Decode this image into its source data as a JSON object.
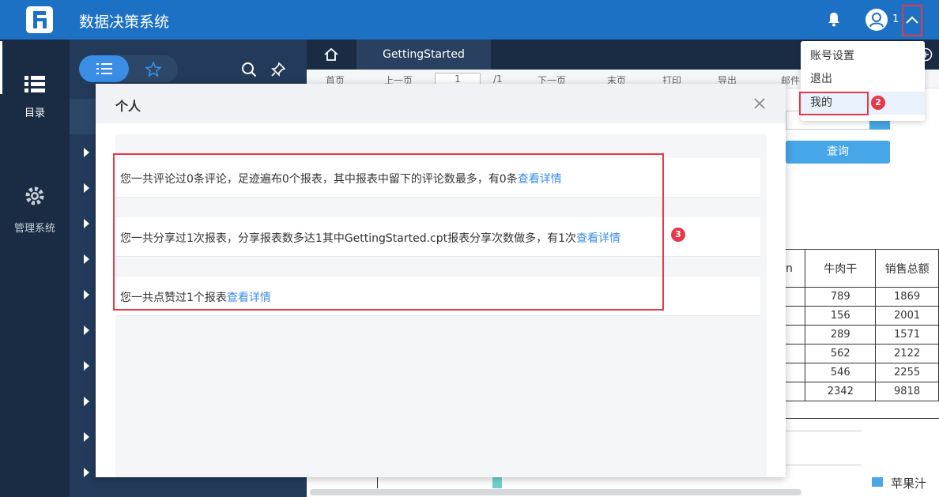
{
  "header": {
    "app_title": "数据决策系统",
    "user_name": "1",
    "icons": [
      "logo-icon",
      "bell-icon",
      "user-avatar-icon",
      "chevron-up-icon"
    ]
  },
  "rail": {
    "items": [
      {
        "label": "目录",
        "icon": "list-icon"
      },
      {
        "label": "管理系统",
        "icon": "gear-icon"
      }
    ]
  },
  "tabs": {
    "active_label": "GettingStarted"
  },
  "toolbar": {
    "items": [
      "首页",
      "上一页",
      "1",
      "/1",
      "下一页",
      "末页",
      "打印",
      "导出",
      "邮件"
    ]
  },
  "report": {
    "query_label": "查询",
    "table_header": [
      "n",
      "牛肉干",
      "销售总额"
    ],
    "rows": [
      [
        "",
        "789",
        "1869"
      ],
      [
        "",
        "156",
        "2001"
      ],
      [
        "",
        "289",
        "1571"
      ],
      [
        "",
        "562",
        "2122"
      ],
      [
        "",
        "546",
        "2255"
      ],
      [
        "",
        "2342",
        "9818"
      ]
    ],
    "legend_label": "苹果汁"
  },
  "dropdown": {
    "items": [
      "账号设置",
      "退出",
      "我的"
    ]
  },
  "modal": {
    "title": "个人",
    "stats": [
      {
        "text": "您一共评论过0条评论，足迹遍布0个报表，其中报表中留下的评论数最多，有0条",
        "link": "查看详情"
      },
      {
        "text": "您一共分享过1次报表，分享报表数多达1其中GettingStarted.cpt报表分享次数做多，有1次",
        "link": "查看详情"
      },
      {
        "text": "您一共点赞过1个报表",
        "link": "查看详情"
      }
    ]
  },
  "annotations": [
    "1",
    "2",
    "3"
  ],
  "colors": {
    "header_bg": "#1d71c5",
    "rail_bg": "#1a2b44",
    "panel_bg": "#233a5a",
    "accent": "#3a8ee6",
    "annotation_red": "#e5394a"
  }
}
